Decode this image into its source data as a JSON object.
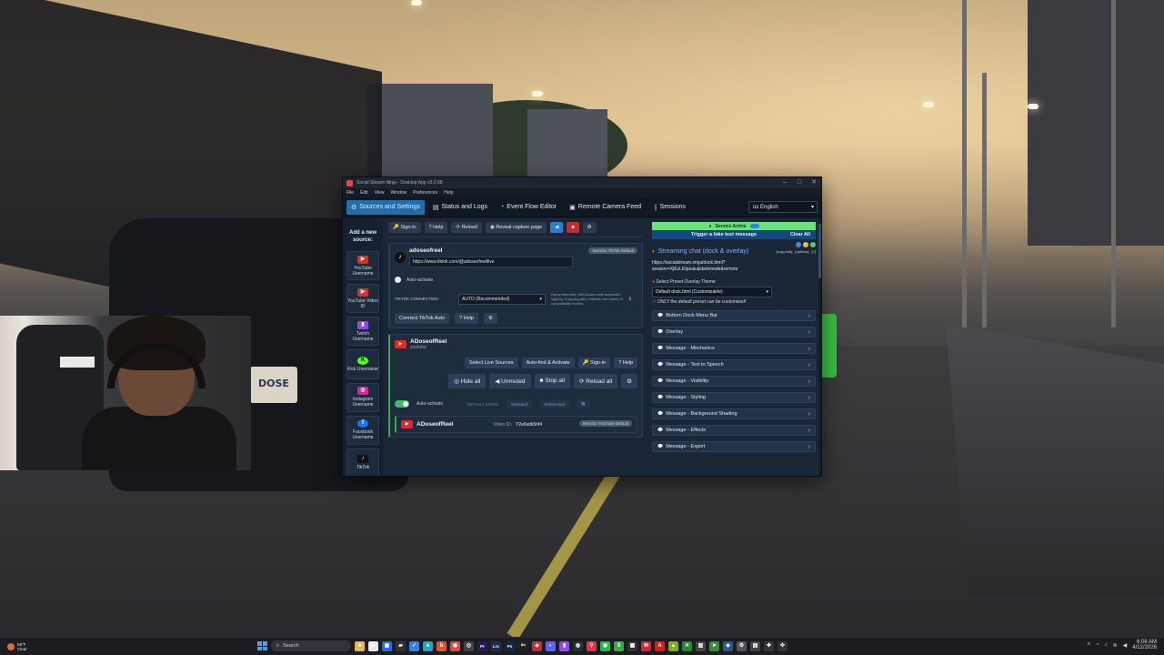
{
  "window": {
    "title": "Social Stream Ninja - Desktop App v0.2.58",
    "menu": [
      "File",
      "Edit",
      "View",
      "Window",
      "Preferences",
      "Help"
    ]
  },
  "tabs": [
    {
      "label": "Sources and Settings",
      "icon": "gear-icon"
    },
    {
      "label": "Status and Logs",
      "icon": "list-icon"
    },
    {
      "label": "Event Flow Editor",
      "icon": "flow-icon"
    },
    {
      "label": "Remote Camera Feed",
      "icon": "camera-icon"
    },
    {
      "label": "Sessions",
      "icon": "sessions-icon"
    }
  ],
  "language": {
    "flag": "us",
    "label": "English"
  },
  "sidebar": {
    "heading": "Add a new source:",
    "sources": [
      {
        "label": "YouTube Username",
        "color": "#e02b2b",
        "icon": "youtube-icon"
      },
      {
        "label": "YouTube Video ID",
        "color": "#e02b2b",
        "icon": "youtube-icon"
      },
      {
        "label": "Twitch Username",
        "color": "#9146ff",
        "icon": "twitch-icon"
      },
      {
        "label": "Kick Username",
        "color": "#53fc18",
        "icon": "kick-icon"
      },
      {
        "label": "Instagram Username",
        "color": "#d6249f",
        "icon": "instagram-icon"
      },
      {
        "label": "Facebook Username",
        "color": "#1877f2",
        "icon": "facebook-icon"
      },
      {
        "label": "TikTok",
        "color": "#111111",
        "icon": "tiktok-icon"
      }
    ]
  },
  "toolbar": {
    "sign_in": "Sign-in",
    "help": "Help",
    "reload": "Reload",
    "reveal": "Reveal capture page"
  },
  "tiktok_card": {
    "name": "adoseofreel",
    "pill": "Session TikTok Default",
    "url": "https://www.tiktok.com/@adoseofreellive",
    "auto_activate": "Auto-activate",
    "connection_label": "TIKTOK CONNECTION",
    "connection_value": "AUTO (Recommended)",
    "connection_note": "Recommended: WebSocket with automatic signing. If signing fails, fallback can switch to compatibility modes.",
    "connect_button": "Connect TikTok Auto",
    "help": "Help"
  },
  "youtube_card": {
    "name": "ADoseofReel",
    "platform": "youtube",
    "select_live": "Select Live Sources",
    "auto_find": "Auto-find & Activate",
    "sign_in": "Sign-in",
    "help": "Help",
    "hide_all": "Hide all",
    "unmuted": "Unmuted",
    "stop_all": "Stop all",
    "reload_all": "Reload all",
    "auto_activate": "Auto-activate",
    "default_mode": "DEFAULT MODE:",
    "mode_standard": "Standard",
    "mode_websocket": "WebSocket"
  },
  "youtube_sub": {
    "name": "ADoseofReel",
    "video_id_label": "Video ID:",
    "video_id": "Y2e6sdk5hf4",
    "pill": "Session YouTube Default"
  },
  "right_panel": {
    "service": "Service Active",
    "trigger": "Trigger a fake test message",
    "clear_all": "Clear All",
    "chat_title": "Streaming chat (dock & overlay)",
    "copy_link": "[copy link]",
    "options": "[options]",
    "help_q": "[?]",
    "dock_url": "https://socialstream.ninja/dock.html?session=XjEzLEfpeaiu&darkmode&remote",
    "preset_label": "Select Preset Overlay Theme",
    "preset_value": "Default dock.html (Customizable)",
    "preset_note": "ONLY the default preset can be customized!",
    "sections": [
      {
        "label": "Bottom Dock Menu Bar",
        "icon": ""
      },
      {
        "label": "Overlay",
        "icon": ""
      },
      {
        "label": "Message - Mechanics",
        "icon": "⚙"
      },
      {
        "label": "Message - Text to Speech",
        "icon": "♪"
      },
      {
        "label": "Message - Visibility",
        "icon": "◉"
      },
      {
        "label": "Message - Styling",
        "icon": "✎"
      },
      {
        "label": "Message - Background Shading",
        "icon": "▦"
      },
      {
        "label": "Message - Effects",
        "icon": "✦"
      },
      {
        "label": "Message - Export",
        "icon": "▤"
      }
    ]
  },
  "webcam": {
    "plate": "DOSE"
  },
  "taskbar": {
    "weather_temp": "59°F",
    "weather_desc": "Clear",
    "search_placeholder": "Search",
    "time": "6:08 AM",
    "date": "4/12/2026",
    "apps": [
      {
        "icon": "files-icon",
        "color": "#e8b84a",
        "glyph": "■"
      },
      {
        "icon": "media-icon",
        "color": "#e8e8e8",
        "glyph": "▶"
      },
      {
        "icon": "store-icon",
        "color": "#2b6be0",
        "glyph": "▣"
      },
      {
        "icon": "terminal-icon",
        "color": "#333",
        "glyph": "▰"
      },
      {
        "icon": "todo-icon",
        "color": "#3a7ee0",
        "glyph": "✓"
      },
      {
        "icon": "edge-icon",
        "color": "#1fa6c7",
        "glyph": "e"
      },
      {
        "icon": "brave-icon",
        "color": "#e0562b",
        "glyph": "b"
      },
      {
        "icon": "chrome-icon",
        "color": "#e04a3a",
        "glyph": "◉"
      },
      {
        "icon": "obs-icon",
        "color": "#444",
        "glyph": "◎"
      },
      {
        "icon": "premiere-icon",
        "color": "#2a1a5a",
        "glyph": "Pr"
      },
      {
        "icon": "lightroom-icon",
        "color": "#1b2d4a",
        "glyph": "Lrc"
      },
      {
        "icon": "photoshop-icon",
        "color": "#102a45",
        "glyph": "Ps"
      },
      {
        "icon": "capcut-icon",
        "color": "#222",
        "glyph": "✂"
      },
      {
        "icon": "ssn-icon",
        "color": "#c43030",
        "glyph": "◈"
      },
      {
        "icon": "discord-icon",
        "color": "#5865f2",
        "glyph": "◐"
      },
      {
        "icon": "twitch-app-icon",
        "color": "#9146ff",
        "glyph": "▮"
      },
      {
        "icon": "steam-icon",
        "color": "#233",
        "glyph": "◍"
      },
      {
        "icon": "maps-icon",
        "color": "#e0354a",
        "glyph": "⚲"
      },
      {
        "icon": "spotify-icon",
        "color": "#1db954",
        "glyph": "◉"
      },
      {
        "icon": "notes-icon",
        "color": "#2bb04a",
        "glyph": "S"
      },
      {
        "icon": "grid-icon",
        "color": "#333",
        "glyph": "▦"
      },
      {
        "icon": "mail-icon",
        "color": "#d23",
        "glyph": "✉"
      },
      {
        "icon": "acrobat-icon",
        "color": "#d02020",
        "glyph": "A"
      },
      {
        "icon": "nvidia-icon",
        "color": "#76b900",
        "glyph": "▲"
      },
      {
        "icon": "xbox-icon",
        "color": "#2a8a2a",
        "glyph": "✕"
      },
      {
        "icon": "windows-tool-icon",
        "color": "#444",
        "glyph": "▥"
      },
      {
        "icon": "arrow-app-icon",
        "color": "#3a8a3a",
        "glyph": "➤"
      },
      {
        "icon": "vs-icon",
        "color": "#2a5a8a",
        "glyph": "◆"
      },
      {
        "icon": "settings-app-icon",
        "color": "#555",
        "glyph": "⚙"
      },
      {
        "icon": "app2-icon",
        "color": "#444",
        "glyph": "▤"
      },
      {
        "icon": "plus-icon",
        "color": "#333",
        "glyph": "✚"
      },
      {
        "icon": "tool-icon",
        "color": "#333",
        "glyph": "✜"
      }
    ]
  }
}
